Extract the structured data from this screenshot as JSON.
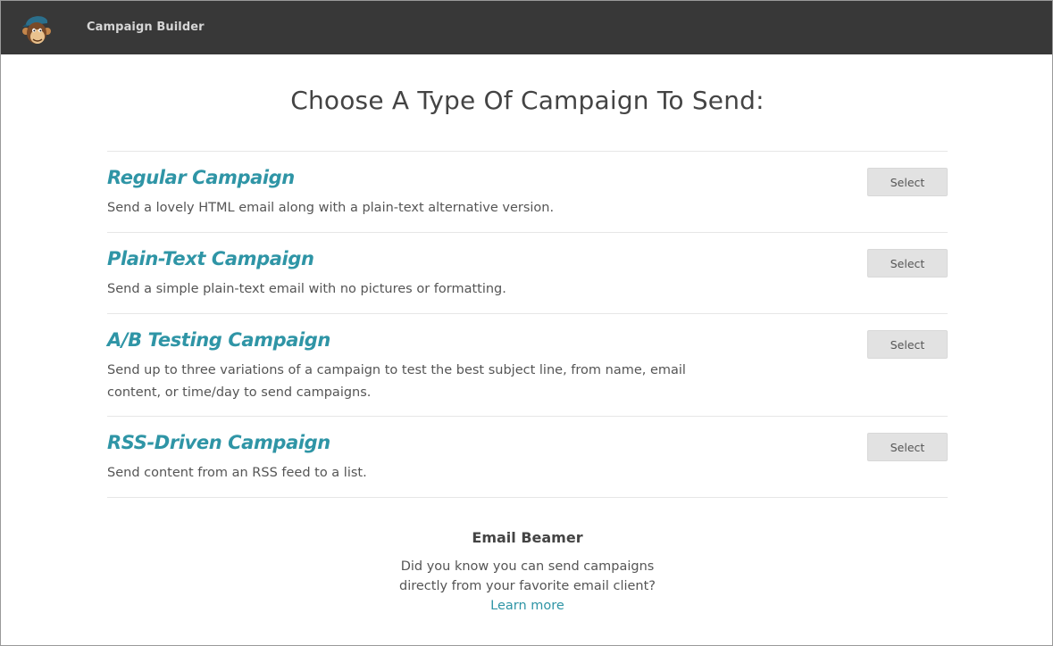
{
  "header": {
    "app_title": "Campaign Builder",
    "logo_icon": "chimp-mascot-icon"
  },
  "main": {
    "heading": "Choose A Type Of Campaign To Send:",
    "campaign_types": [
      {
        "title": "Regular Campaign",
        "description": "Send a lovely HTML email along with a plain-text alternative version.",
        "button": "Select"
      },
      {
        "title": "Plain-Text Campaign",
        "description": "Send a simple plain-text email with no pictures or formatting.",
        "button": "Select"
      },
      {
        "title": "A/B Testing Campaign",
        "description": "Send up to three variations of a campaign to test the best subject line, from name, email content, or time/day to send campaigns.",
        "button": "Select"
      },
      {
        "title": "RSS-Driven Campaign",
        "description": "Send content from an RSS feed to a list.",
        "button": "Select"
      }
    ]
  },
  "email_beamer": {
    "title": "Email Beamer",
    "text_line1": "Did you know you can send campaigns",
    "text_line2": "directly from your favorite email client?",
    "link": "Learn more"
  },
  "colors": {
    "topbar": "#383838",
    "accent": "#2f95a6",
    "button_bg": "#e2e2e2"
  }
}
